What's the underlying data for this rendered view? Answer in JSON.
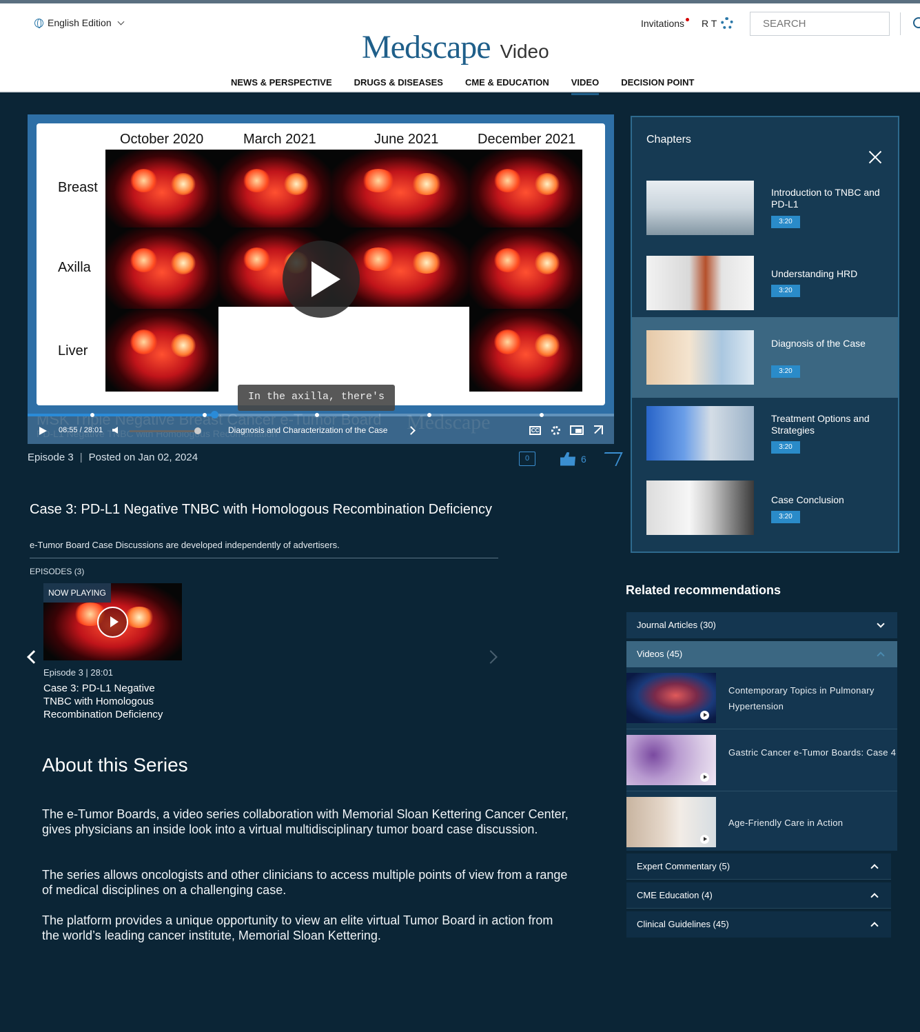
{
  "header": {
    "edition": "English Edition",
    "brand": "Medscape",
    "section": "Video",
    "invitations": "Invitations",
    "user_initials": "R T",
    "search_placeholder": "SEARCH",
    "nav": [
      "NEWS & PERSPECTIVE",
      "DRUGS & DISEASES",
      "CME & EDUCATION",
      "VIDEO",
      "DECISION POINT"
    ],
    "active_nav": "VIDEO"
  },
  "player": {
    "slide": {
      "columns": [
        "October 2020",
        "March 2021",
        "June 2021",
        "December 2021"
      ],
      "rows": [
        "Breast",
        "Axilla",
        "Liver"
      ]
    },
    "caption": "In the axilla, there's",
    "overlay_title": "MSK Triple Negative Breast Cancer e-Tumor Board",
    "overlay_subtitle": "PD-L1 Negative TNBC with Homologous Recombination",
    "watermark": "Medscape",
    "current_time": "08:55",
    "duration": "28:01",
    "time_display": "08:55 / 28:01",
    "progress_fraction": 0.318,
    "current_chapter": "Diagnosis and Characterization of the Case",
    "cc_label": "CC"
  },
  "meta": {
    "episode": "Episode 3",
    "posted": "Posted on Jan 02, 2024",
    "comments": "0",
    "likes": "6"
  },
  "episode_title": "Case 3: PD-L1 Negative TNBC with Homologous Recombination Deficiency",
  "disclaimer": "e-Tumor Board Case Discussions are developed independently of advertisers.",
  "episodes": {
    "label": "EPISODES (3)",
    "now_playing": "NOW PLAYING",
    "card_info": "Episode 3 | 28:01",
    "card_title": "Case 3: PD-L1 Negative TNBC with Homologous Recombination Deficiency"
  },
  "about": {
    "heading": "About this Series",
    "paragraphs": [
      "The e-Tumor Boards, a video series collaboration with Memorial Sloan Kettering Cancer Center, gives physicians an inside look into a virtual multidisciplinary tumor board case discussion.",
      "The series allows oncologists and other clinicians to access multiple points of view from a range of medical disciplines on a challenging case.",
      "The platform provides a unique opportunity to view an elite virtual Tumor Board in action from the world’s leading cancer institute, Memorial Sloan Kettering."
    ]
  },
  "chapters": {
    "title": "Chapters",
    "items": [
      {
        "name": "Introduction to TNBC and PD-L1",
        "duration": "3:20",
        "thumb": "clinic-corridor-image"
      },
      {
        "name": "Understanding HRD",
        "duration": "3:20",
        "thumb": "doctor-stethoscope-image"
      },
      {
        "name": "Diagnosis of the Case",
        "duration": "3:20",
        "thumb": "lab-sample-image",
        "active": true
      },
      {
        "name": "Treatment Options and Strategies",
        "duration": "3:20",
        "thumb": "gloved-hands-image"
      },
      {
        "name": "Case Conclusion",
        "duration": "3:20",
        "thumb": "microscope-image"
      }
    ]
  },
  "related": {
    "heading": "Related recommendations",
    "sections": [
      {
        "label": "Journal Articles (30)",
        "state": "collapsed"
      },
      {
        "label": "Videos (45)",
        "state": "expanded"
      },
      {
        "label": "Expert Commentary (5)",
        "state": "collapsed"
      },
      {
        "label": "CME Education (4)",
        "state": "collapsed"
      },
      {
        "label": "Clinical Guidelines (45)",
        "state": "collapsed"
      }
    ],
    "videos": [
      {
        "title": "Contemporary Topics in Pulmonary Hypertension",
        "thumb": "lungs-illustration"
      },
      {
        "title": "Gastric Cancer e-Tumor Boards: Case 4",
        "thumb": "histology-slide"
      },
      {
        "title": "Age-Friendly Care in Action",
        "thumb": "caregiver-patient-photo"
      }
    ]
  },
  "colors": {
    "page_bg": "#0b2536",
    "accent": "#2a8bc9",
    "brand": "#1f5f8a",
    "panel": "#163a53"
  }
}
